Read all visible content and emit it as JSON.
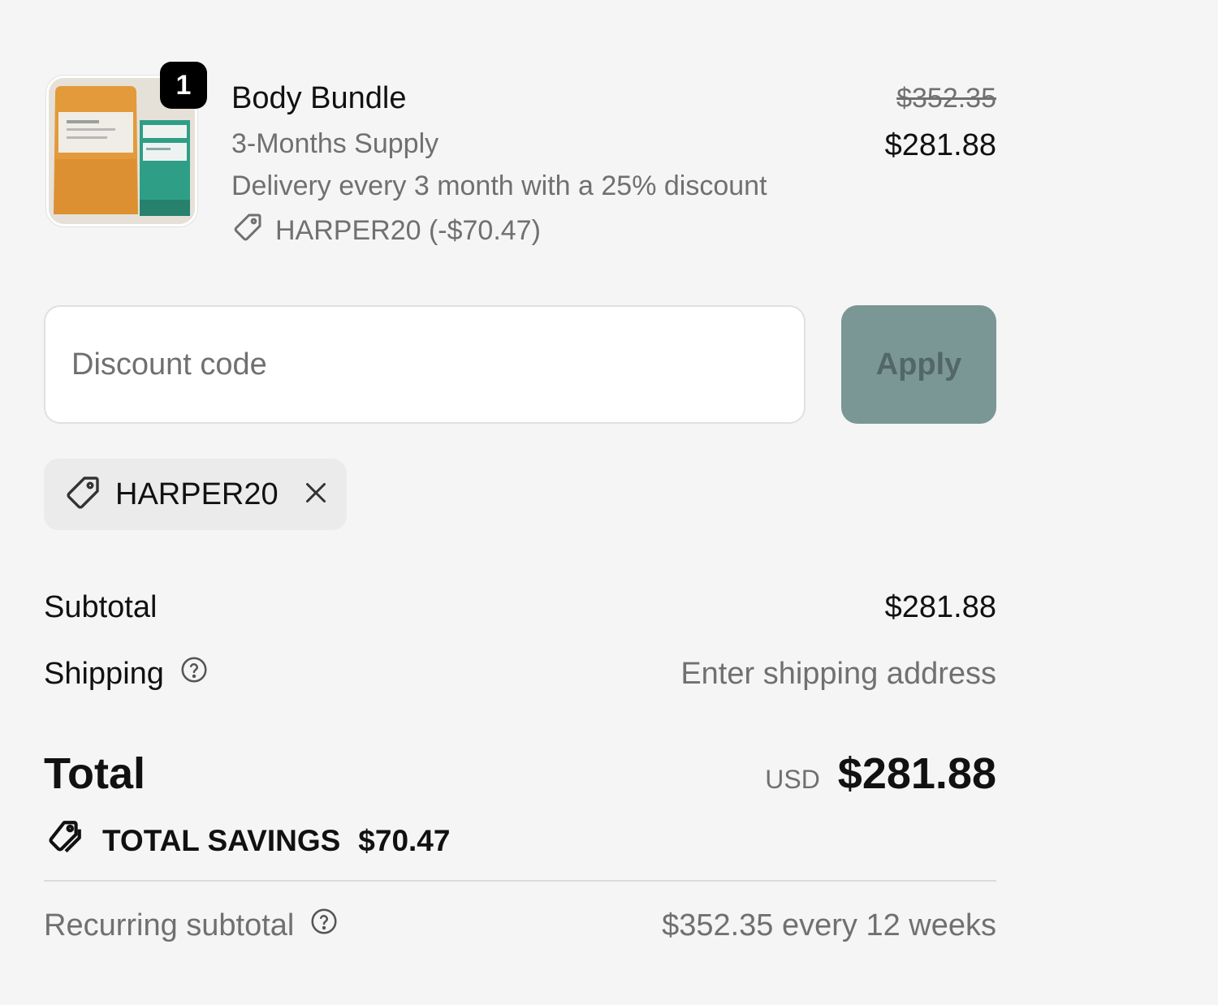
{
  "product": {
    "quantity": "1",
    "title": "Body Bundle",
    "variant": "3-Months Supply",
    "plan": "Delivery every 3 month with a 25% discount",
    "discount_line": "HARPER20 (-$70.47)",
    "original_price": "$352.35",
    "price": "$281.88",
    "image_icon": "product-image"
  },
  "discount_form": {
    "placeholder": "Discount code",
    "value": "",
    "apply_label": "Apply"
  },
  "applied_code": {
    "code": "HARPER20",
    "icon": "tag-icon",
    "remove_icon": "close-icon"
  },
  "totals": {
    "subtotal_label": "Subtotal",
    "subtotal_value": "$281.88",
    "shipping_label": "Shipping",
    "shipping_value": "Enter shipping address",
    "total_label": "Total",
    "currency": "USD",
    "total_value": "$281.88",
    "savings_label": "TOTAL SAVINGS",
    "savings_value": "$70.47",
    "recurring_label": "Recurring subtotal",
    "recurring_value": "$352.35 every 12 weeks"
  },
  "colors": {
    "background": "#f5f5f5",
    "apply_button": "#7a9795",
    "muted_text": "#707070"
  }
}
